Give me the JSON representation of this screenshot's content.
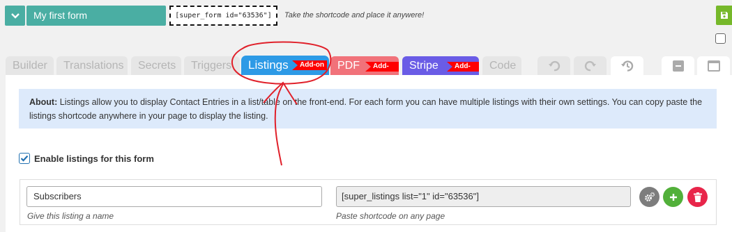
{
  "header": {
    "form_title": "My first form",
    "shortcode": "[super_form id=\"63536\"]",
    "shortcode_hint": "Take the shortcode and place it anywere!"
  },
  "tabs": [
    {
      "label": "Builder"
    },
    {
      "label": "Translations"
    },
    {
      "label": "Secrets"
    },
    {
      "label": "Triggers"
    },
    {
      "label": "Listings",
      "badge": "Add-on",
      "active": true
    },
    {
      "label": "PDF",
      "badge": "Add-on"
    },
    {
      "label": "Stripe",
      "badge": "Add-on"
    },
    {
      "label": "Code"
    }
  ],
  "toolbar_icons": [
    "undo-icon",
    "redo-icon",
    "history-icon",
    "minimize-icon",
    "maximize-icon",
    "save-icon"
  ],
  "about": {
    "label": "About:",
    "text": " Listings allow you to display Contact Entries in a list/table on the front-end. For each form you can have multiple listings with their own settings. You can copy paste the listings shortcode anywhere in your page to display the listing."
  },
  "enable_listings": {
    "label": "Enable listings for this form",
    "checked": true
  },
  "listing": {
    "name_value": "Subscribers",
    "name_hint": "Give this listing a name",
    "shortcode_value": "[super_listings list=\"1\" id=\"63536\"]",
    "shortcode_hint": "Paste shortcode on any page"
  },
  "colors": {
    "teal": "#4aaea3",
    "listings_blue": "#2d9ae6",
    "pdf_red": "#f1727a",
    "stripe_purple": "#6a5ce6",
    "addon_red": "#ff0000",
    "save_green": "#76b82a",
    "about_bg": "#ddeafb",
    "annotation_red": "#e0202a"
  }
}
